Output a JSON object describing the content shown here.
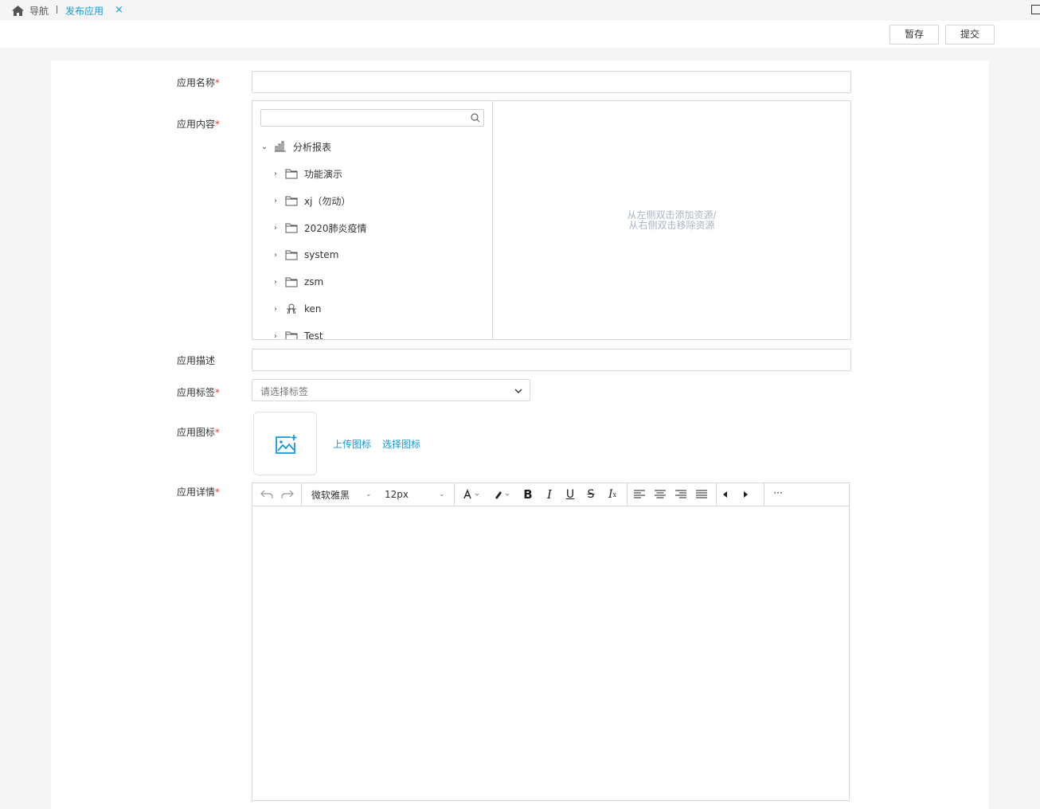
{
  "tabs": {
    "home_label": "导航",
    "active_label": "发布应用",
    "close_glyph": "×"
  },
  "toolbar": {
    "save_draft_label": "暂存",
    "submit_label": "提交"
  },
  "form": {
    "name": {
      "label": "应用名称",
      "required": "*",
      "value": ""
    },
    "content": {
      "label": "应用内容",
      "required": "*",
      "search_placeholder": "",
      "tree": [
        {
          "label": "分析报表",
          "icon": "report-chart-icon",
          "expanded": true
        },
        {
          "label": "功能演示",
          "icon": "folder-icon"
        },
        {
          "label": "xj（勿动）",
          "icon": "folder-icon"
        },
        {
          "label": "2020肺炎疫情",
          "icon": "folder-icon"
        },
        {
          "label": "system",
          "icon": "folder-icon"
        },
        {
          "label": "zsm",
          "icon": "folder-icon"
        },
        {
          "label": "ken",
          "icon": "user-folder-icon"
        },
        {
          "label": "Test",
          "icon": "folder-icon"
        }
      ],
      "hint_line1": "从左侧双击添加资源/",
      "hint_line2": "从右侧双击移除资源"
    },
    "description": {
      "label": "应用描述",
      "value": ""
    },
    "tags": {
      "label": "应用标签",
      "required": "*",
      "placeholder": "请选择标签"
    },
    "icon": {
      "label": "应用图标",
      "required": "*",
      "upload_link": "上传图标",
      "choose_link": "选择图标"
    },
    "details": {
      "label": "应用详情",
      "required": "*",
      "font_family": "微软雅黑",
      "font_size": "12px",
      "more_glyph": "···"
    }
  },
  "colors": {
    "accent": "#1a97d6",
    "required": "#e53b3b",
    "hint": "#a9b4c2",
    "border": "#d8d8d8"
  }
}
